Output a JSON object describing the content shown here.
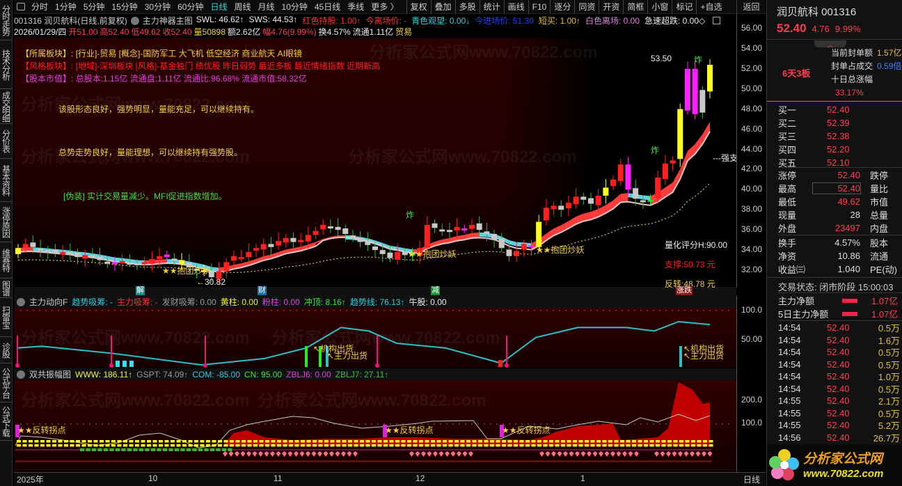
{
  "sidebar": [
    "分时走势",
    "技术分析",
    "成交明细",
    "分价表",
    "基本资料",
    "涨停原因",
    "维赛特",
    "图谱",
    "扫雷宝",
    "诊股",
    "公式平台",
    "公式下载"
  ],
  "toolbar": {
    "periods": [
      "分时",
      "1分钟",
      "5分钟",
      "15分钟",
      "30分钟",
      "60分钟",
      "日线",
      "周线",
      "月线",
      "10分钟",
      "45日线",
      "季线",
      "更多 〉"
    ],
    "active": "日线",
    "buttons": [
      "复权",
      "叠加",
      "多股",
      "统计",
      "画线",
      "F10",
      "逐分",
      "同资",
      "开资",
      "简框",
      "小窗",
      "标记",
      "+自选"
    ],
    "back": "返回"
  },
  "info": {
    "title": "001316 润贝航科(日线,前复权)",
    "indicator": "主力神器主图",
    "items": [
      {
        "t": "SWL: 46.62↑",
        "c": "#eeeeee"
      },
      {
        "t": "SWS: 44.53↑",
        "c": "#eeeeee"
      },
      {
        "t": "红色持股: 1.00↑",
        "c": "#ff3030"
      },
      {
        "t": "今离场价: -",
        "c": "#ff3030"
      },
      {
        "t": "青色观望: 0.00↓",
        "c": "#38d0d8"
      },
      {
        "t": "今进场价: 51.30",
        "c": "#2040ff"
      },
      {
        "t": "短买: 1.00↑",
        "c": "#e0c040"
      },
      {
        "t": "白色离场: 0.00",
        "c": "#e080e0"
      },
      {
        "t": "急速超跌: 0.00◇",
        "c": "#eeeeee"
      }
    ]
  },
  "quote": {
    "date": "2026/01/29/四",
    "open": "开51.00",
    "high": "高52.40",
    "low": "低49.62",
    "close": "收52.40",
    "vol": "量50898",
    "amount": "额2.62亿",
    "change": "幅4.76(9.99%)",
    "turnover": "换4.57%",
    "float": "流通1.11亿",
    "industry": "贸易"
  },
  "notes": {
    "sector_label": "【所属板块】:",
    "sector": "[行业]-贸易 [概念]-国防军工 大飞机 低空经济 商业航天 AI眼镜",
    "style_label": "【风格板块】:",
    "style": "[地域]-深圳板块 [风格]-基金独门 绩优股 昨日弱势 最近多板 最近情绪指数 近期新高",
    "cap_label": "【股本市值】:",
    "cap": "总股本:1.15亿 流通盘:1.11亿 流通比:96.68% 流通市值:58.32亿",
    "comment1": "该股形态良好，强势明显，量能充足，可以继续持有。",
    "comment2": "总势走势良好，量能理想，可以继续持有强势股。",
    "comment3": "[伪装] 实计交易量减少。MFI促进指数增加。"
  },
  "annotations": {
    "baotuan": "★★抱团炒妖",
    "low": "←30.82",
    "high": "53.50",
    "zha": "炸",
    "strong": "---强支",
    "score": "量化评分H:90.00",
    "support": "支撑:50.73 元",
    "reversal": "反转:48.78 元"
  },
  "events": [
    {
      "t": "解",
      "c": "#1a8a8a"
    },
    {
      "t": "财",
      "c": "#1a6a9a"
    },
    {
      "t": "减",
      "c": "#1a8a3a"
    },
    {
      "t": "涨跌",
      "c": "#8a1a1a"
    }
  ],
  "watermark": "分析家公式网www.70822.com",
  "ind1": {
    "name": "主力动向F",
    "items": [
      {
        "t": "趋势吸筹: -",
        "c": "#38c8d8"
      },
      {
        "t": "主力吸筹: -",
        "c": "#ff3030"
      },
      {
        "t": "发财吸筹: 0.00",
        "c": "#999999"
      },
      {
        "t": "黄柱: 0.00",
        "c": "#f0f040"
      },
      {
        "t": "粉柱: 0.00",
        "c": "#e040e0"
      },
      {
        "t": "冲顶: 8.16↑",
        "c": "#40e040"
      },
      {
        "t": "趋势线: 76.13↑",
        "c": "#38c8d8"
      },
      {
        "t": "牛股: 0.00",
        "c": "#eeeeee"
      }
    ],
    "labels": [
      "↖机构出货",
      "↖主力出货"
    ],
    "axis": [
      "100.0",
      "50.00"
    ]
  },
  "ind2": {
    "name": "双共振幅图",
    "items": [
      {
        "t": "WWW: 186.11↑",
        "c": "#f0f040"
      },
      {
        "t": "GSPT: 74.09↑",
        "c": "#999999"
      },
      {
        "t": "COM: -85.00",
        "c": "#38c8d8"
      },
      {
        "t": "CN: 95.00",
        "c": "#40e040"
      },
      {
        "t": "ZBLJ6: 0.00",
        "c": "#e040e0"
      },
      {
        "t": "ZBLJ7: 27.11↑",
        "c": "#40c040"
      }
    ],
    "marker": "★★反转拐点",
    "axis": [
      "200.0",
      "100.0"
    ]
  },
  "xaxis": [
    "2025年",
    "10",
    "11",
    "12",
    "1",
    "日线"
  ],
  "main_axis": [
    "56.00",
    "54.00",
    "52.00",
    "50.00",
    "48.00",
    "46.00",
    "44.00",
    "42.00",
    "40.00",
    "38.00",
    "36.00",
    "34.00",
    "32.00"
  ],
  "right": {
    "name": "润贝航科 001316",
    "price": "52.40",
    "chg": "4.76",
    "pct": "9.99%",
    "board": "6天3板",
    "seal": [
      {
        "l": "当前封单额",
        "v": "1.57亿",
        "c": "#e0c040"
      },
      {
        "l": "封单占成交",
        "v": "0.59倍",
        "c": "#4080ff"
      },
      {
        "l": "十日总涨幅",
        "v": "33.17%",
        "c": "#ff3f4f"
      }
    ],
    "bids": [
      [
        "买一",
        "52.40"
      ],
      [
        "买二",
        "52.39"
      ],
      [
        "买三",
        "52.38"
      ],
      [
        "买四",
        "52.20"
      ],
      [
        "买五",
        "52.10"
      ]
    ],
    "stats": [
      [
        "涨停",
        "52.40",
        "跌停"
      ],
      [
        "最高",
        "52.40",
        "量比"
      ],
      [
        "最低",
        "49.62",
        "市值"
      ],
      [
        "现量",
        "28",
        "总量"
      ],
      [
        "外盘",
        "23497",
        "内盘"
      ]
    ],
    "stats2": [
      [
        "换手",
        "4.57%",
        "股本"
      ],
      [
        "净资",
        "10.86",
        "流通"
      ],
      [
        "收益㈢",
        "1.040",
        "PE(动)"
      ]
    ],
    "status": "交易状态: 闭市阶段 15:00:03",
    "flow": [
      [
        "主力净额",
        "1.07亿"
      ],
      [
        "5日主力净额",
        "1.07亿"
      ]
    ],
    "ticks": [
      [
        "14:54",
        "52.40",
        "0.5万"
      ],
      [
        "14:54",
        "52.40",
        "1.6万"
      ],
      [
        "14:54",
        "52.40",
        "0.5万"
      ],
      [
        "14:54",
        "52.40",
        "0.5万"
      ],
      [
        "14:54",
        "52.40",
        "1.0万"
      ],
      [
        "14:54",
        "52.40",
        "0.5万"
      ],
      [
        "14:55",
        "52.40",
        "2.1万"
      ],
      [
        "14:55",
        "52.40",
        "0.5万"
      ],
      [
        "14:55",
        "52.40",
        "5.2万"
      ],
      [
        "14:56",
        "52.40",
        "26.7万"
      ]
    ],
    "logo_cn": "分析家公式网",
    "logo_url": "www.70822.com"
  },
  "chart_data": {
    "type": "candlestick",
    "ylim": [
      31,
      56
    ],
    "close": [
      34.2,
      34.6,
      34.3,
      34.0,
      33.9,
      33.7,
      33.8,
      33.6,
      33.3,
      33.5,
      33.2,
      33.0,
      32.8,
      32.6,
      32.9,
      32.7,
      32.5,
      32.8,
      33.1,
      33.4,
      33.3,
      33.0,
      32.6,
      32.3,
      32.0,
      31.8,
      31.3,
      31.9,
      32.8,
      33.4,
      33.3,
      33.8,
      34.2,
      34.6,
      34.3,
      34.9,
      35.2,
      34.8,
      35.0,
      35.5,
      35.9,
      36.5,
      36.3,
      36.0,
      35.6,
      35.2,
      34.8,
      34.5,
      34.0,
      33.6,
      33.2,
      33.8,
      33.5,
      33.6,
      34.2,
      36.5,
      36.2,
      36.0,
      35.8,
      36.3,
      36.1,
      36.5,
      36.0,
      35.6,
      35.0,
      34.2,
      33.4,
      33.9,
      34.6,
      34.3,
      36.8,
      38.2,
      38.4,
      38.0,
      38.7,
      39.3,
      39.0,
      38.6,
      39.4,
      40.2,
      41.0,
      42.5,
      40.0,
      39.1,
      38.9,
      39.0,
      41.2,
      42.6,
      42.9,
      48.0,
      52.0,
      47.5,
      49.9,
      52.4
    ],
    "special": {
      "0": "y",
      "13": "m",
      "20": "m",
      "22": "y",
      "25": "y",
      "53": "g",
      "60": "m",
      "69": "m",
      "70": "y",
      "79": "y",
      "82": "m",
      "85": "g",
      "89": "y",
      "90": "m",
      "91": "m",
      "92": "w",
      "93": "y"
    },
    "trend_line": [
      36,
      39,
      27,
      7,
      18,
      36,
      71,
      65,
      44,
      36,
      10,
      54,
      71,
      71,
      65,
      81,
      76
    ]
  }
}
